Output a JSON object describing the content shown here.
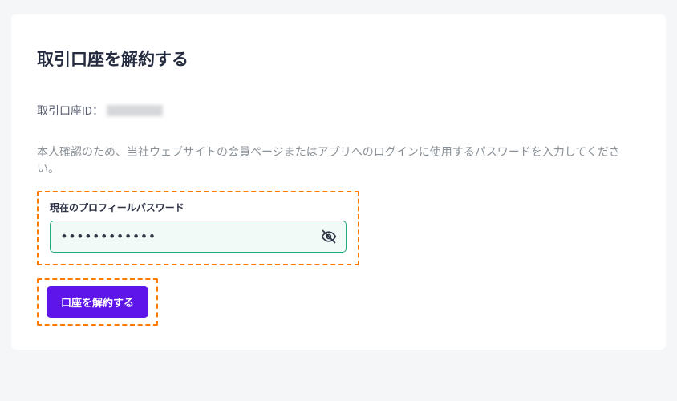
{
  "page": {
    "title": "取引口座を解約する",
    "accountIdLabel": "取引口座ID：",
    "instruction": "本人確認のため、当社ウェブサイトの会員ページまたはアプリへのログインに使用するパスワードを入力してください。",
    "passwordFieldLabel": "現在のプロフィールパスワード",
    "passwordValue": "••••••••••••",
    "submitLabel": "口座を解約する"
  }
}
